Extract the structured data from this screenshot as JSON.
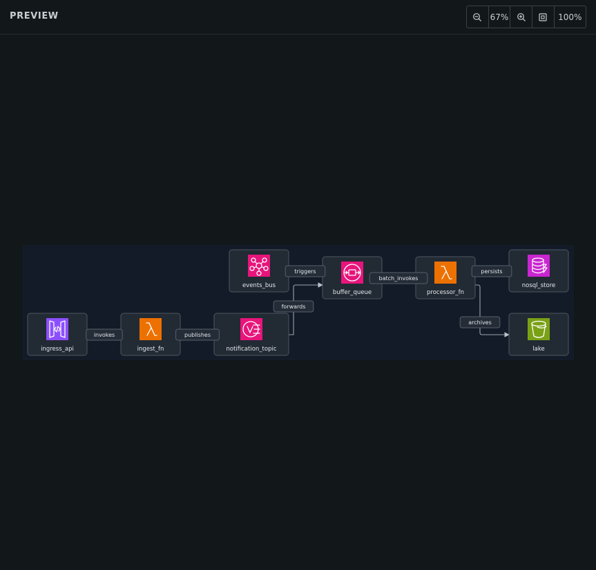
{
  "header": {
    "title": "PREVIEW",
    "zoom_level": "67%",
    "reset_label": "100%"
  },
  "diagram": {
    "nodes": [
      {
        "id": "events_bus",
        "label": "events_bus",
        "icon": "eventbridge-icon",
        "color": "#e7157b"
      },
      {
        "id": "buffer_queue",
        "label": "buffer_queue",
        "icon": "sqs-queue-icon",
        "color": "#e7157b"
      },
      {
        "id": "processor_fn",
        "label": "processor_fn",
        "icon": "lambda-icon",
        "color": "#ed7100"
      },
      {
        "id": "nosql_store",
        "label": "nosql_store",
        "icon": "dynamodb-icon",
        "color": "#c925d1"
      },
      {
        "id": "ingress_api",
        "label": "ingress_api",
        "icon": "api-gateway-icon",
        "color": "#8c4fff"
      },
      {
        "id": "ingest_fn",
        "label": "ingest_fn",
        "icon": "lambda-icon",
        "color": "#ed7100"
      },
      {
        "id": "notification_topic",
        "label": "notification_topic",
        "icon": "sns-topic-icon",
        "color": "#e7157b"
      },
      {
        "id": "lake",
        "label": "lake",
        "icon": "s3-bucket-icon",
        "color": "#7aa116"
      }
    ],
    "edges": [
      {
        "from": "ingress_api",
        "to": "ingest_fn",
        "label": "invokes"
      },
      {
        "from": "ingest_fn",
        "to": "notification_topic",
        "label": "publishes"
      },
      {
        "from": "notification_topic",
        "to": "buffer_queue",
        "label": "forwards"
      },
      {
        "from": "events_bus",
        "to": "buffer_queue",
        "label": "triggers"
      },
      {
        "from": "buffer_queue",
        "to": "processor_fn",
        "label": "batch_invokes"
      },
      {
        "from": "processor_fn",
        "to": "nosql_store",
        "label": "persists"
      },
      {
        "from": "processor_fn",
        "to": "lake",
        "label": "archives"
      }
    ]
  }
}
